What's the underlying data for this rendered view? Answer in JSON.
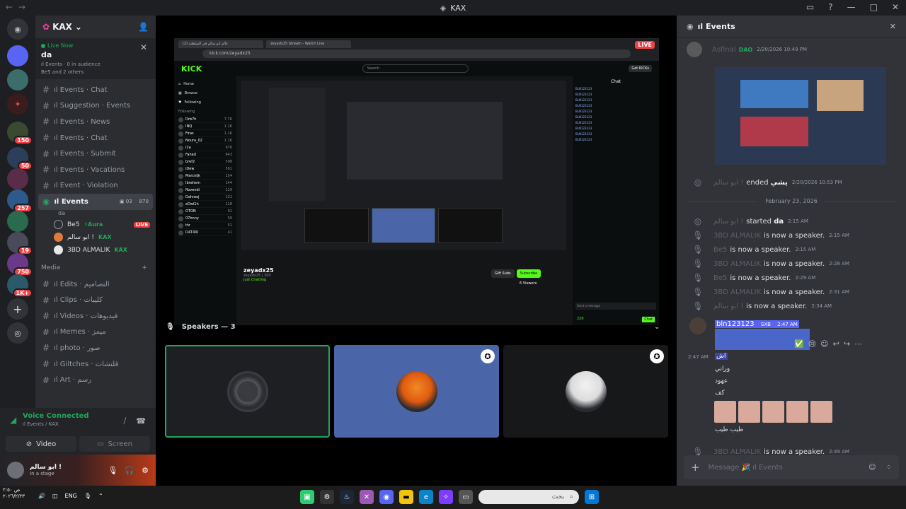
{
  "window": {
    "title": "KAX"
  },
  "servers": [
    {
      "badge": ""
    },
    {
      "badge": ""
    },
    {
      "badge": ""
    },
    {
      "badge": "150"
    },
    {
      "badge": "50"
    },
    {
      "badge": ""
    },
    {
      "badge": "257"
    },
    {
      "badge": ""
    },
    {
      "badge": "19"
    },
    {
      "badge": ""
    },
    {
      "badge": "750"
    },
    {
      "badge": "1K+"
    }
  ],
  "sidebar": {
    "server_name": "KAX",
    "live_now": {
      "label": "Live Now",
      "name": "da",
      "sub": "ıl Events · 0 in audience",
      "others": "Be5 and 2 others"
    },
    "channels": [
      {
        "label": "ıl Events · Chat"
      },
      {
        "label": "ıl Suggestion · Events"
      },
      {
        "label": "ıl Events · News"
      },
      {
        "label": "ıl Events · Chat"
      },
      {
        "label": "ıl Events · Submit"
      },
      {
        "label": "ıl Events · Vacations"
      },
      {
        "label": "ıl Event · Violation"
      }
    ],
    "active_channel": {
      "label": "ıl Events",
      "video": "03",
      "count": "870",
      "topic": "da"
    },
    "speakers": [
      {
        "name": "Be5",
        "tag": "⚡Aura",
        "live": "LIVE"
      },
      {
        "name": "ابو سالم !",
        "tag": "KAX",
        "live": ""
      },
      {
        "name": "3BD ALMALIK",
        "tag": "KAX",
        "live": ""
      }
    ],
    "media_category": "Media",
    "media_channels": [
      {
        "label": "ıl Edits · التصاميم"
      },
      {
        "label": "ıl Clips · كليبات"
      },
      {
        "label": "ıl Videos · فيديوهات"
      },
      {
        "label": "ıl Memes · ميمز"
      },
      {
        "label": "ıl photo · صور"
      },
      {
        "label": "ıl Giltches · قلتشات"
      },
      {
        "label": "ıl Art · رسم"
      }
    ]
  },
  "voice": {
    "status": "Voice Connected",
    "location": "ıl Events / KAX",
    "video_label": "Video",
    "screen_label": "Screen"
  },
  "user": {
    "name": "ابو سالم !",
    "status": "In a stage"
  },
  "stage": {
    "live_badge": "LIVE",
    "speakers_header": "Speakers — 3",
    "stream": {
      "tab1": "عالم ابو سالم في السلطنة (2)",
      "tab2": "zeyadx25 Stream - Watch Live",
      "url": "kick.com/zeyadx25",
      "logo": "KICK",
      "search_placeholder": "Search",
      "get_kicks": "Get KICKs",
      "nav": [
        "Home",
        "Browse",
        "Following"
      ],
      "following_header": "Following",
      "following": [
        {
          "name": "Drb7h",
          "viewers": "7.7K"
        },
        {
          "name": "INQ",
          "viewers": "1.1K"
        },
        {
          "name": "Firas",
          "viewers": "1.1K"
        },
        {
          "name": "Noura_02",
          "viewers": "1.1K"
        },
        {
          "name": "i2a",
          "viewers": "976"
        },
        {
          "name": "Fahad",
          "viewers": "643"
        },
        {
          "name": "bref2",
          "viewers": "598"
        },
        {
          "name": "iDew",
          "viewers": "561"
        },
        {
          "name": "Marcnijk",
          "viewers": "154"
        },
        {
          "name": "Ibrahem",
          "viewers": "144"
        },
        {
          "name": "Rovendi",
          "viewers": "129"
        },
        {
          "name": "Dahrooj",
          "viewers": "121"
        },
        {
          "name": "xDwi1h",
          "viewers": "118"
        },
        {
          "name": "OTON",
          "viewers": "91"
        },
        {
          "name": "07hnny",
          "viewers": "59"
        },
        {
          "name": "ttz",
          "viewers": "51"
        },
        {
          "name": "D4T4XI",
          "viewers": "41"
        }
      ],
      "streamer": "zeyadx25",
      "stream_title": "zeyadx25 | 300",
      "category": "Just Chatting",
      "gift_subs": "Gift Subs",
      "subscribe": "Subscribe",
      "viewers": "6 Viewers",
      "chat_header": "Chat",
      "chat_users": [
        "BLN123123",
        "BLN123123",
        "BLN123123",
        "BLN123123",
        "BLN123123",
        "BLN123123",
        "BLN123123",
        "BLN123123",
        "BLN123123",
        "BLN123123"
      ],
      "send_placeholder": "Send a message",
      "chat_count": "220",
      "chat_button": "Chat"
    }
  },
  "chat": {
    "title": "ıl Events",
    "top_user": "Asfinal",
    "top_tag": "DAO",
    "top_time": "2/20/2026 10:49 PM",
    "ended": {
      "user": "ابو سالم !",
      "action": "ended",
      "name": "يشي",
      "time": "2/20/2026 10:53 PM"
    },
    "date_divider": "February 23, 2026",
    "events": [
      {
        "user": "ابو سالم !",
        "action": "started",
        "name": "da",
        "time": "2:15 AM"
      },
      {
        "user": "3BD ALMALIK",
        "action": "is now a speaker.",
        "name": "",
        "time": "2:15 AM"
      },
      {
        "user": "Be5",
        "action": "is now a speaker.",
        "name": "",
        "time": "2:15 AM"
      },
      {
        "user": "3BD ALMALIK",
        "action": "is now a speaker.",
        "name": "",
        "time": "2:28 AM"
      },
      {
        "user": "Be5",
        "action": "is now a speaker.",
        "name": "",
        "time": "2:29 AM"
      },
      {
        "user": "3BD ALMALIK",
        "action": "is now a speaker.",
        "name": "",
        "time": "2:31 AM"
      },
      {
        "user": "ابو سالم !",
        "action": "is now a speaker.",
        "name": "",
        "time": "2:34 AM"
      }
    ],
    "message": {
      "author": "bln123123",
      "tag": "SXB",
      "time": "2:47 AM",
      "side_time": "2:47 AM",
      "lines": [
        "اش",
        "وراني",
        "عهود",
        "كف"
      ],
      "last": "طيب طيب"
    },
    "last_event": {
      "user": "3BD ALMALIK",
      "action": "is now a speaker.",
      "time": "2:49 AM"
    },
    "input_placeholder": "Message 🎉 ıl Events"
  },
  "taskbar": {
    "time": "ص ٢:٥٠",
    "date": "٢٠٢٦/٢/٢٣",
    "lang": "ENG",
    "search_placeholder": "بحث"
  }
}
